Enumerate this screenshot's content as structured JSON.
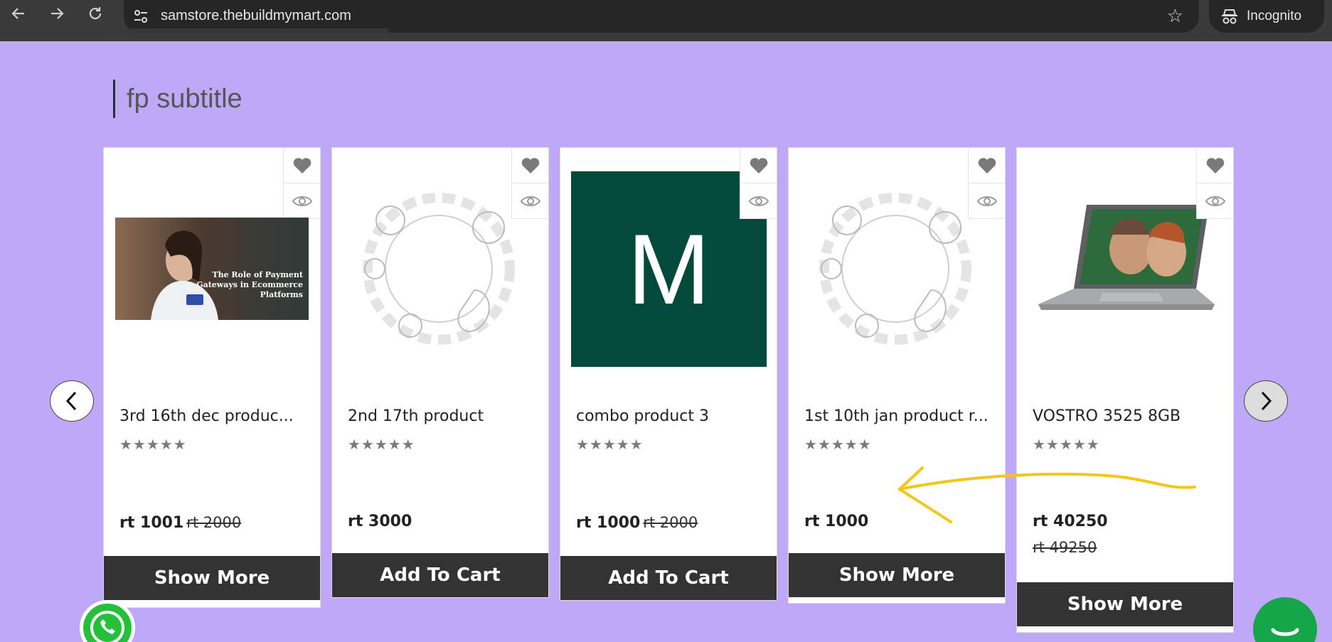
{
  "browser": {
    "url": "samstore.thebuildmymart.com",
    "incognito_label": "Incognito"
  },
  "section": {
    "subtitle": "fp subtitle"
  },
  "products": [
    {
      "name": "3rd 16th dec produc...",
      "price": "rt 1001",
      "old_price": "rt 2000",
      "button": "Show More",
      "image_caption": "The Role of Payment Gateways in Ecommerce Platforms",
      "rating": "★★★★★"
    },
    {
      "name": "2nd 17th product",
      "price": "rt 3000",
      "old_price": "",
      "button": "Add To Cart",
      "rating": "★★★★★"
    },
    {
      "name": "combo product 3",
      "price": "rt 1000",
      "old_price": "rt 2000",
      "button": "Add To Cart",
      "image_letter": "M",
      "rating": "★★★★★"
    },
    {
      "name": "1st 10th jan product r...",
      "price": "rt 1000",
      "old_price": "",
      "button": "Show More",
      "rating": "★★★★★"
    },
    {
      "name": "VOSTRO 3525 8GB",
      "price": "rt 40250",
      "old_price": "rt 49250",
      "button": "Show More",
      "rating": "★★★★★"
    }
  ],
  "colors": {
    "page_bg": "#c0a8f8",
    "button_bg": "#333333",
    "annotation": "#f5c518",
    "whatsapp": "#25c03b",
    "chat": "#16a64a"
  },
  "icons": [
    "back-icon",
    "forward-icon",
    "reload-icon",
    "site-settings-icon",
    "bookmark-star-icon",
    "incognito-icon",
    "heart-icon",
    "eye-icon",
    "chevron-left-icon",
    "chevron-right-icon",
    "whatsapp-icon",
    "chat-icon"
  ]
}
